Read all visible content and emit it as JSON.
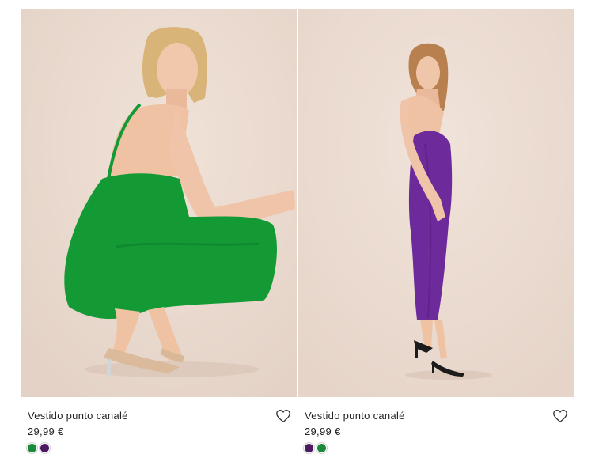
{
  "products": [
    {
      "name": "Vestido punto canalé",
      "price": "29,99 €",
      "photo_bg": "#ecdcd2",
      "dress_color": "#149a35",
      "swatches": [
        {
          "color": "#1a8a3a",
          "selected": true
        },
        {
          "color": "#4b1a63",
          "selected": false
        }
      ],
      "favorite_icon": "heart-outline-icon"
    },
    {
      "name": "Vestido punto canalé",
      "price": "29,99 €",
      "photo_bg": "#ecdcd2",
      "dress_color": "#6c2a9b",
      "swatches": [
        {
          "color": "#4b1a63",
          "selected": true
        },
        {
          "color": "#1a8a3a",
          "selected": false
        }
      ],
      "favorite_icon": "heart-outline-icon"
    }
  ]
}
